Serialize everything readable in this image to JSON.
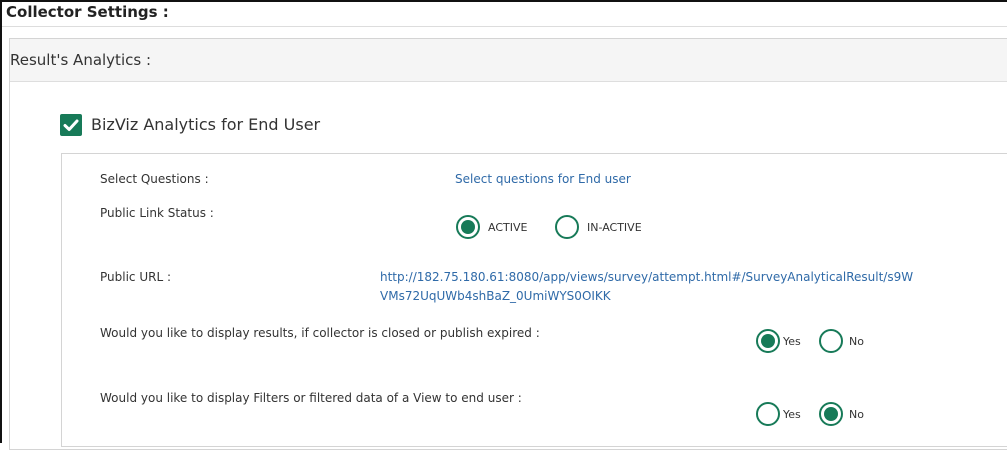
{
  "header": {
    "title": "Collector Settings :"
  },
  "section": {
    "title": "Result's Analytics :",
    "checkbox_label": "BizViz Analytics for End User",
    "checkbox_checked": true
  },
  "select_questions": {
    "label": "Select Questions :",
    "link": "Select questions for End user"
  },
  "public_link_status": {
    "label": "Public Link Status :",
    "options": [
      "ACTIVE",
      "IN-ACTIVE"
    ],
    "selected": "ACTIVE"
  },
  "public_url": {
    "label": "Public URL :",
    "line1": "http://182.75.180.61:8080/app/views/survey/attempt.html#/SurveyAnalyticalResult/s9W",
    "line2": "VMs72UqUWb4shBaZ_0UmiWYS0OIKK"
  },
  "display_results": {
    "label": "Would you like to display results, if collector is closed or publish expired :",
    "options": [
      "Yes",
      "No"
    ],
    "selected": "Yes"
  },
  "display_filters": {
    "label": "Would you like to display Filters or filtered data of a View to end user :",
    "options": [
      "Yes",
      "No"
    ],
    "selected": "No"
  },
  "colors": {
    "accent": "#177a58",
    "link": "#2f6aa8"
  }
}
